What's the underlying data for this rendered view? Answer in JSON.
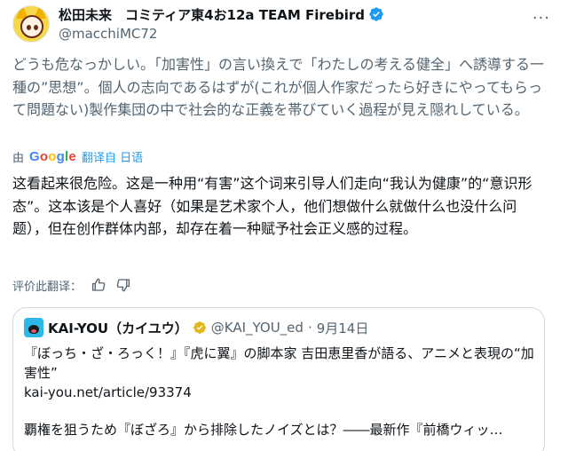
{
  "author": {
    "display_name": "松田未来　コミティア東4お12a TEAM Firebird",
    "handle": "@macchiMC72"
  },
  "original_text": "どうも危なっかしい。「加害性」の言い換えで「わたしの考える健全」へ誘導する一種の”思想”。個人の志向であるはずが(これが個人作家だったら好きにやってもらって問題ない)製作集団の中で社会的な正義を帯びていく過程が見え隠れしている。",
  "translation": {
    "by_label": "由",
    "provider": "Google",
    "translated_from": "翻译自 日语"
  },
  "translated_text": "这看起来很危险。这是一种用“有害”这个词来引导人们走向“我认为健康”的“意识形态”。这本该是个人喜好（如果是艺术家个人，他们想做什么就做什么也没什么问题），但在创作群体内部，却存在着一种赋予社会正义感的过程。",
  "feedback": {
    "label": "评价此翻译："
  },
  "quoted_tweet": {
    "display_name": "KAI-YOU（カイユウ）",
    "handle": "@KAI_YOU_ed",
    "separator": "·",
    "date": "9月14日",
    "body": "『ぼっち・ざ・ろっく！』『虎に翼』の脚本家 吉田恵里香が語る、アニメと表現の“加害性”",
    "link": "kai-you.net/article/93374",
    "description": "覇権を狙うため『ぼざろ』から排除したノイズとは？――最新作『前橋ウィッ…"
  },
  "icons": {
    "verified": "verified-badge-icon",
    "verified_org": "gold-verified-badge-icon",
    "more": "more-options-icon",
    "thumbs_up": "thumbs-up-icon",
    "thumbs_down": "thumbs-down-icon"
  },
  "colors": {
    "accent": "#1d9bf0",
    "text_primary": "#0f1419",
    "text_secondary": "#536471",
    "border": "#cfd9de",
    "org_badge": "#e2b719"
  }
}
